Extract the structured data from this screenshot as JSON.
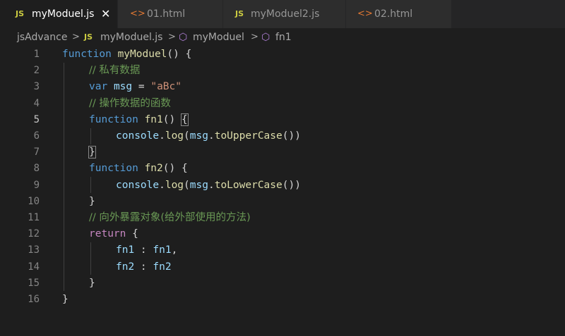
{
  "tabs": [
    {
      "icon": "JS",
      "label": "myModuel.js",
      "active": true,
      "close": "✕"
    },
    {
      "icon": "<>",
      "label": "01.html",
      "active": false
    },
    {
      "icon": "JS",
      "label": "myModuel2.js",
      "active": false
    },
    {
      "icon": "<>",
      "label": "02.html",
      "active": false
    }
  ],
  "breadcrumb": {
    "folder": "jsAdvance",
    "file_icon": "JS",
    "file": "myModuel.js",
    "function1": "myModuel",
    "function2": "fn1",
    "separator": ">"
  },
  "editor": {
    "line_numbers": [
      "1",
      "2",
      "3",
      "4",
      "5",
      "6",
      "7",
      "8",
      "9",
      "10",
      "11",
      "12",
      "13",
      "14",
      "15",
      "16"
    ],
    "current_line": 5,
    "lines": [
      {
        "t1": "function",
        "t2": " ",
        "t3": "myModuel",
        "t4": "() {"
      },
      {
        "t1": "// 私有数据"
      },
      {
        "t1": "var",
        "t2": " ",
        "t3": "msg",
        "t4": " = ",
        "t5": "\"aBc\""
      },
      {
        "t1": "// 操作数据的函数"
      },
      {
        "t1": "function",
        "t2": " ",
        "t3": "fn1",
        "t4": "() ",
        "t5": "{"
      },
      {
        "t1": "console",
        "t2": ".",
        "t3": "log",
        "t4": "(",
        "t5": "msg",
        "t6": ".",
        "t7": "toUpperCase",
        "t8": "())"
      },
      {
        "t1": "}"
      },
      {
        "t1": "function",
        "t2": " ",
        "t3": "fn2",
        "t4": "() {"
      },
      {
        "t1": "console",
        "t2": ".",
        "t3": "log",
        "t4": "(",
        "t5": "msg",
        "t6": ".",
        "t7": "toLowerCase",
        "t8": "())"
      },
      {
        "t1": "}"
      },
      {
        "t1": "// 向外暴露对象(给外部使用的方法)"
      },
      {
        "t1": "return",
        "t2": " {"
      },
      {
        "t1": "fn1",
        "t2": " : ",
        "t3": "fn1",
        "t4": ","
      },
      {
        "t1": "fn2",
        "t2": " : ",
        "t3": "fn2"
      },
      {
        "t1": "}"
      },
      {
        "t1": "}"
      }
    ]
  },
  "colors": {
    "editor_bg": "#1e1e1e",
    "tab_bar_bg": "#252526",
    "keyword": "#569cd6",
    "control_keyword": "#c586c0",
    "function_name": "#dcdcaa",
    "variable": "#9cdcfe",
    "string": "#ce9178",
    "comment": "#6a9955",
    "js_icon": "#cbcb41",
    "html_icon": "#e37933"
  }
}
